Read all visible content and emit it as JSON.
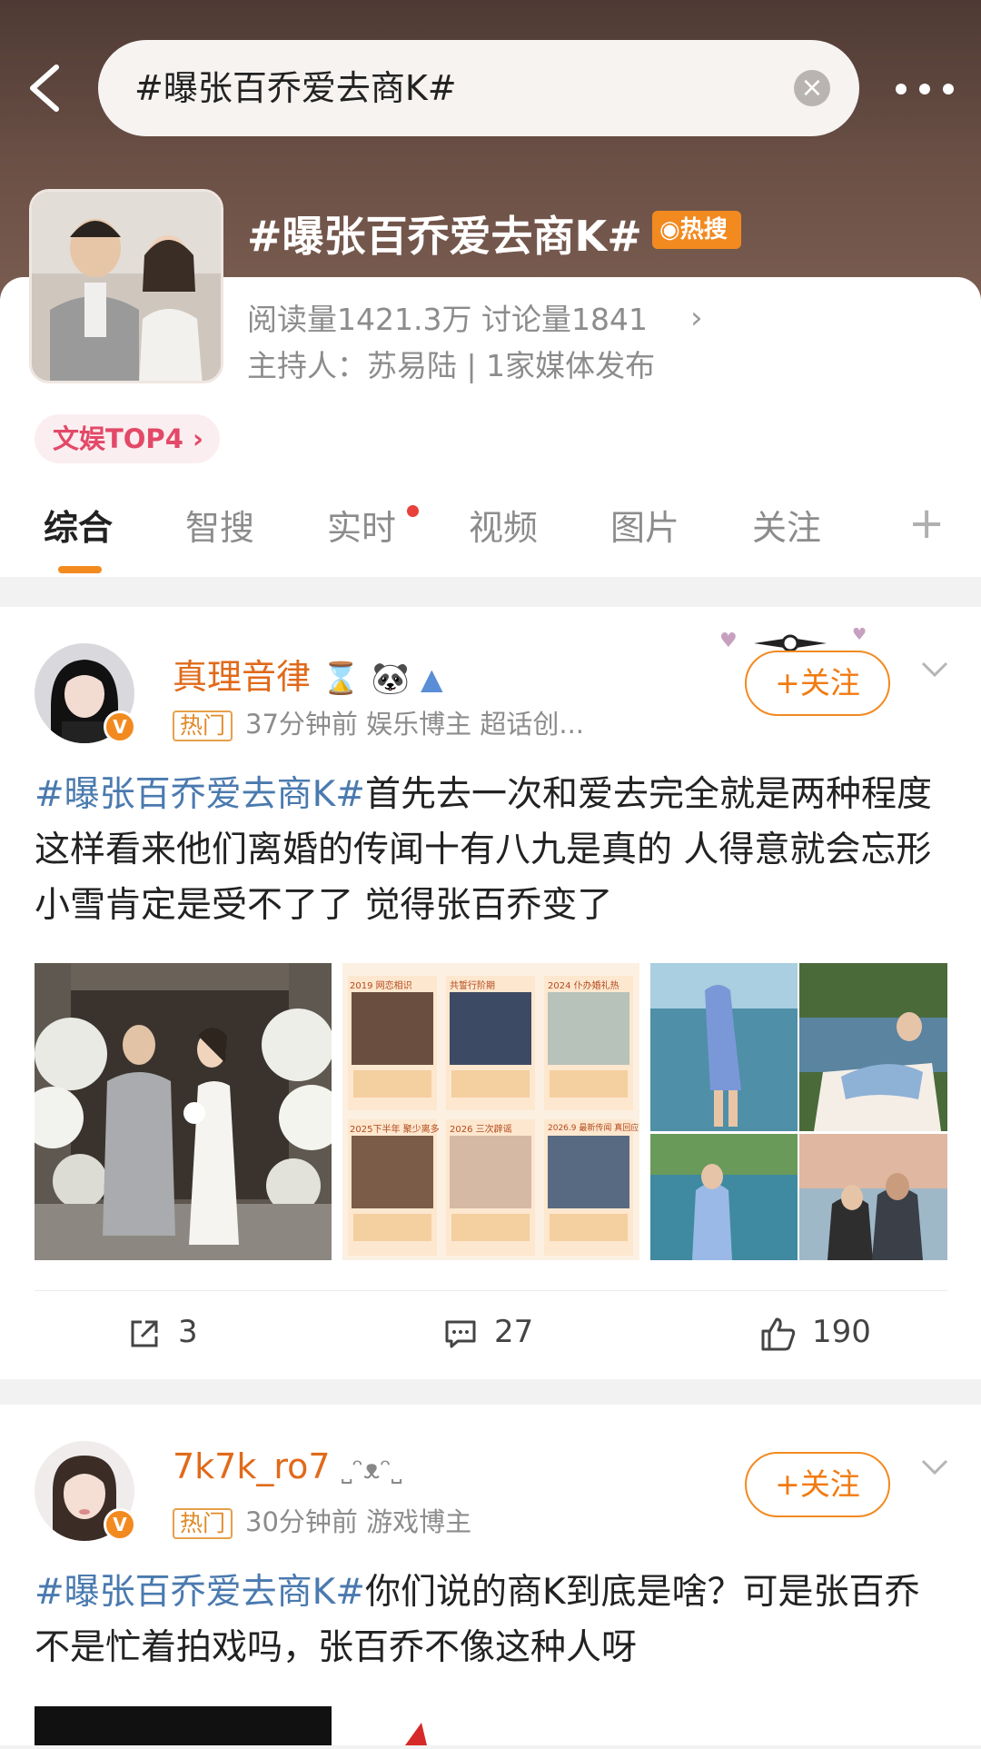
{
  "search": {
    "query": "#曝张百乔爱去商K#"
  },
  "topic": {
    "title": "#曝张百乔爱去商K#",
    "hot_badge": "热搜",
    "stats": "阅读量1421.3万  讨论量1841",
    "host": "主持人：苏易陆 | 1家媒体发布",
    "rank": "文娱TOP4 ›"
  },
  "tabs": [
    "综合",
    "智搜",
    "实时",
    "视频",
    "图片",
    "关注"
  ],
  "posts": [
    {
      "username": "真理音律",
      "hot_tag": "热门",
      "meta": "37分钟前  娱乐博主 超话创...",
      "follow": "+关注",
      "hashtag": "#曝张百乔爱去商K#",
      "text": "首先去一次和爱去完全就是两种程度 这样看来他们离婚的传闻十有八九是真的 人得意就会忘形 小雪肯定是受不了了 觉得张百乔变了",
      "reposts": "3",
      "comments": "27",
      "likes": "190",
      "collage_labels": [
        "2019 网恋相识",
        "共誓行阶期",
        "2024 仆办婚礼热",
        "2025下半年 聚少离多",
        "2026 三次辟谣",
        "2026.9 最新传闻 真回应"
      ]
    },
    {
      "username": "7k7k_ro7",
      "hot_tag": "热门",
      "meta": "30分钟前  游戏博主",
      "follow": "+关注",
      "hashtag": "#曝张百乔爱去商K#",
      "text": "你们说的商K到底是啥？可是张百乔不是忙着拍戏吗，张百乔不像这种人呀"
    }
  ],
  "colors": {
    "accent": "#f28a20",
    "hashtag": "#4a7aaf",
    "username": "#e06a1b",
    "rank": "#e34968"
  }
}
